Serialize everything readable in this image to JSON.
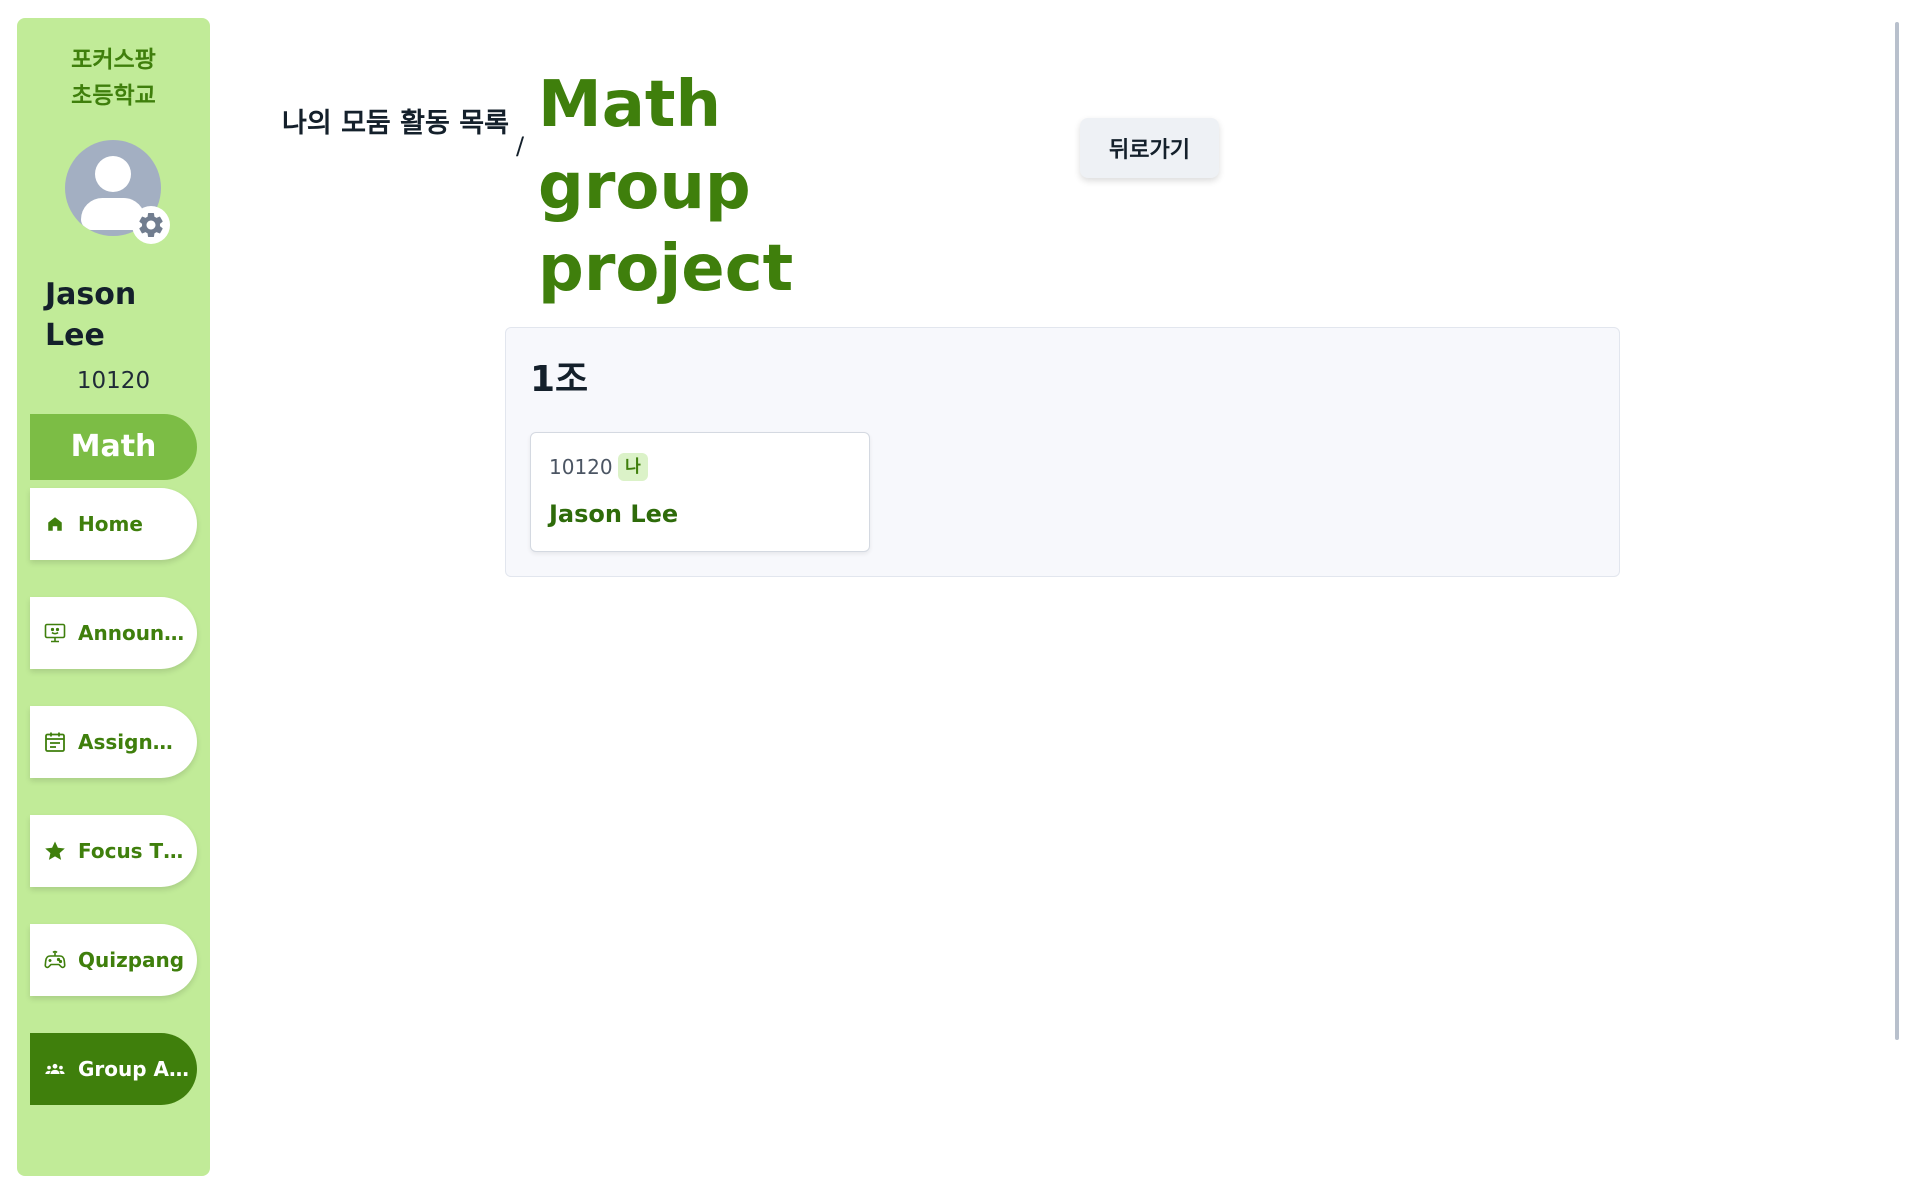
{
  "sidebar": {
    "school_name": "포커스팡\n초등학교",
    "user": {
      "name": "Jason Lee",
      "id": "10120",
      "avatar_icon": "user-avatar-icon",
      "settings_icon": "gear-icon"
    },
    "subject": "Math",
    "nav_items": [
      {
        "label": "Home",
        "icon": "home-icon",
        "active": false
      },
      {
        "label": "Announcements",
        "icon": "monitor-icon",
        "active": false
      },
      {
        "label": "Assignments",
        "icon": "calendar-icon",
        "active": false
      },
      {
        "label": "Focus Time",
        "icon": "star-icon",
        "active": false
      },
      {
        "label": "Quizpang",
        "icon": "gamepad-icon",
        "active": false
      },
      {
        "label": "Group Activities",
        "icon": "group-icon",
        "active": true
      }
    ]
  },
  "header": {
    "breadcrumb_parent": "나의 모둠 활동 목록",
    "separator": "/",
    "title": "Math group project",
    "back_button": "뒤로가기"
  },
  "group": {
    "title": "1조",
    "members": [
      {
        "id": "10120",
        "badge": "나",
        "name": "Jason Lee"
      }
    ]
  },
  "colors": {
    "sidebar_bg": "#c1eb98",
    "accent_dark": "#3f7f0c",
    "accent_mid": "#7cbd45",
    "card_bg": "#f7f8fc"
  }
}
